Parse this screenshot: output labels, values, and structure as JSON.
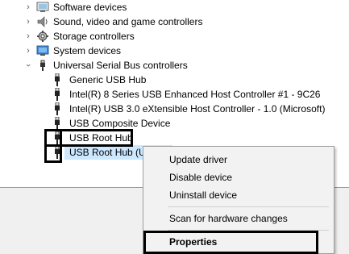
{
  "tree": {
    "categories_top": [
      {
        "label": "Software devices",
        "icon": "software-devices-icon"
      },
      {
        "label": "Sound, video and game controllers",
        "icon": "speaker-icon"
      },
      {
        "label": "Storage controllers",
        "icon": "storage-controller-icon"
      },
      {
        "label": "System devices",
        "icon": "system-devices-icon"
      }
    ],
    "usb_category": {
      "label": "Universal Serial Bus controllers",
      "icon": "usb-controller-icon"
    },
    "usb_devices": [
      {
        "label": "Generic USB Hub"
      },
      {
        "label": "Intel(R) 8 Series USB Enhanced Host Controller #1 - 9C26"
      },
      {
        "label": "Intel(R) USB 3.0 eXtensible Host Controller - 1.0 (Microsoft)"
      },
      {
        "label": "USB Composite Device"
      },
      {
        "label": "USB Root Hub"
      },
      {
        "label": "USB Root Hub (U"
      }
    ]
  },
  "context_menu": {
    "items": [
      {
        "label": "Update driver"
      },
      {
        "label": "Disable device"
      },
      {
        "label": "Uninstall device"
      },
      {
        "label": "Scan for hardware changes"
      },
      {
        "label": "Properties"
      }
    ]
  },
  "colors": {
    "selection": "#cce8ff",
    "highlight_border": "#000000",
    "menu_background": "#f2f2f2"
  }
}
